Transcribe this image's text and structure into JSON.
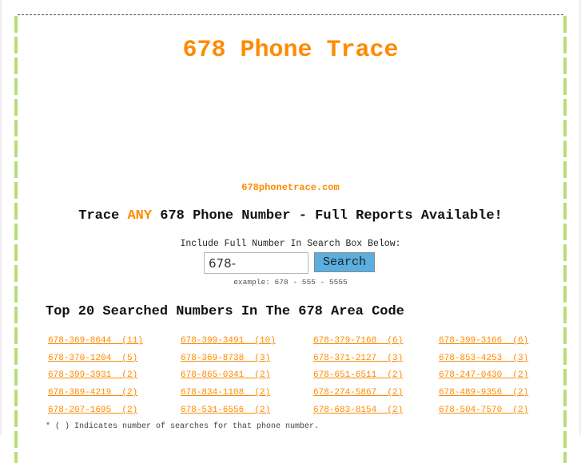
{
  "header": {
    "title": "678 Phone Trace",
    "domain": "678phonetrace.com"
  },
  "tagline": {
    "before": "Trace ",
    "highlight": "ANY",
    "after": " 678 Phone Number - Full Reports Available!"
  },
  "search": {
    "instruction": "Include Full Number In Search Box Below:",
    "input_value": "678-",
    "button_label": "Search",
    "example": "example: 678 - 555 - 5555"
  },
  "top_numbers": {
    "heading": "Top 20 Searched Numbers In The 678 Area Code",
    "rows": [
      [
        "678-369-8644 (11)",
        "678-399-3491 (10)",
        "678-379-7168 (6)",
        "678-399-3166 (6)"
      ],
      [
        "678-370-1204 (5)",
        "678-369-8738 (3)",
        "678-371-2127 (3)",
        "678-853-4253 (3)"
      ],
      [
        "678-399-3931 (2)",
        "678-865-0341 (2)",
        "678-651-6511 (2)",
        "678-247-0430 (2)"
      ],
      [
        "678-389-4219 (2)",
        "678-834-1108 (2)",
        "678-274-5867 (2)",
        "678-489-9356 (2)"
      ],
      [
        "678-207-1695 (2)",
        "678-531-6556 (2)",
        "678-683-8154 (2)",
        "678-504-7570 (2)"
      ]
    ],
    "footnote": "* ( ) Indicates number of searches for that phone number."
  },
  "colors": {
    "accent": "#ff8a00",
    "border_green": "#b9dc78",
    "button_blue": "#5aaee0"
  }
}
